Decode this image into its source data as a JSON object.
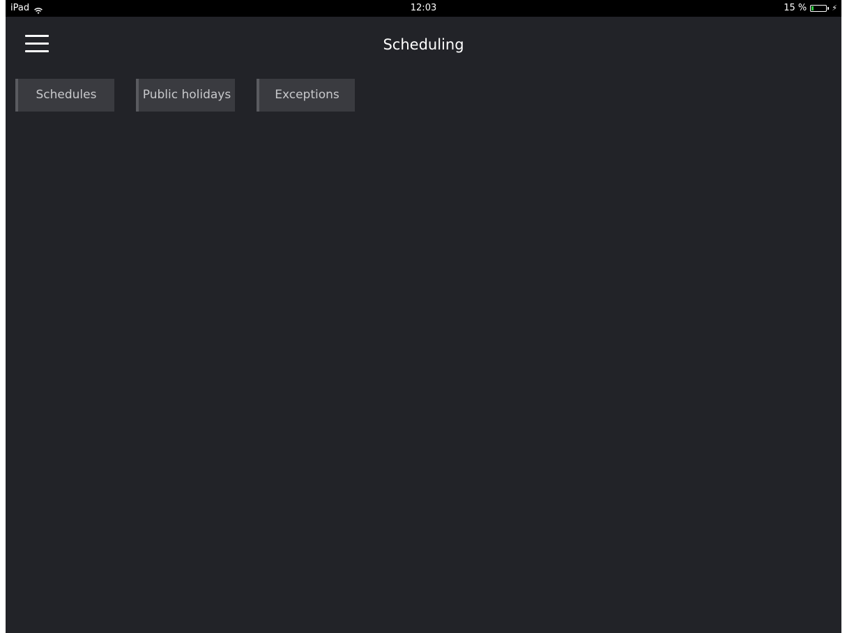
{
  "status_bar": {
    "device": "iPad",
    "time": "12:03",
    "battery_text": "15 %",
    "battery_level_percent": 15,
    "battery_color": "#2ecc40"
  },
  "header": {
    "menu_icon": "hamburger-icon",
    "title": "Scheduling"
  },
  "tabs": [
    {
      "label": "Schedules"
    },
    {
      "label": "Public holidays"
    },
    {
      "label": "Exceptions"
    }
  ],
  "colors": {
    "background": "#222328",
    "tab_background": "#3a3b40",
    "tab_accent": "#5a5b60"
  }
}
